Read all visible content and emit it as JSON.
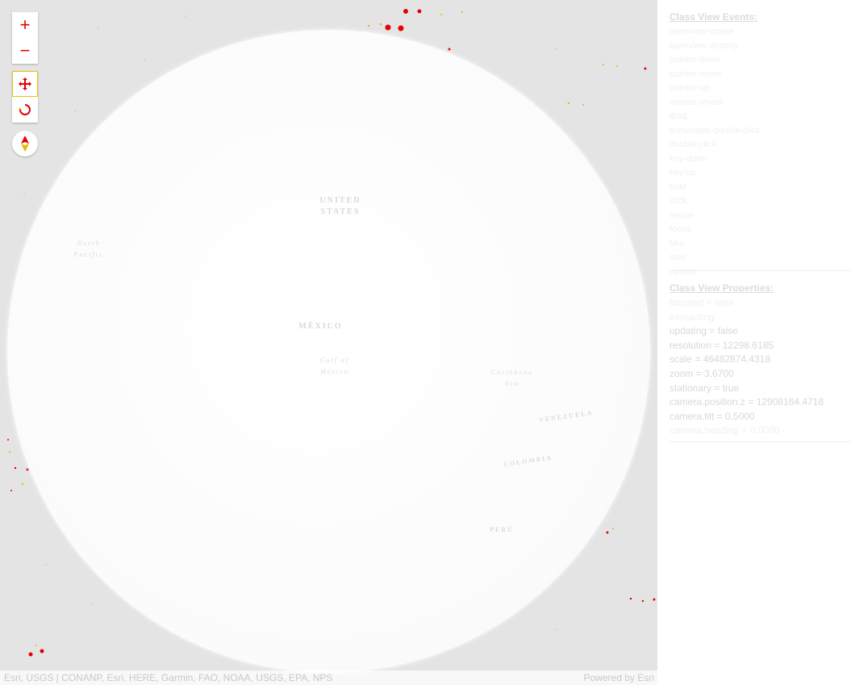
{
  "map": {
    "labels": {
      "united_states": "UNITED STATES",
      "mexico": "MÉXICO",
      "venezuela": "VENEZUELA",
      "colombia": "COLOMBIA",
      "peru": "PERÚ",
      "caribbean": "Caribbean Sea",
      "gulf": "Gulf of Mexico",
      "north_pacific": "North Pacific"
    }
  },
  "controls": {
    "zoom_in": "+",
    "zoom_out": "−",
    "pan_icon": "pan-icon",
    "rotate_icon": "rotate-icon",
    "compass_icon": "compass-icon",
    "accent_color": "#e60000",
    "active_outline_color": "#f0c000"
  },
  "attribution": {
    "sources": "Esri, USGS | CONANP, Esri, HERE, Garmin, FAO, NOAA, USGS, EPA, NPS",
    "powered_by": "Powered by Esri"
  },
  "panel": {
    "events_title": "Class View Events:",
    "events": [
      "layerview-create",
      "layerview-destroy",
      "pointer-down",
      "pointer-move",
      "pointer-up",
      "mouse-wheel",
      "drag",
      "immediate-double-click",
      "double-click",
      "key-down",
      "key-up",
      "hold",
      "click",
      "resize",
      "focus",
      "blur",
      "size",
      "update"
    ],
    "properties_title": "Class View Properties:",
    "properties": [
      {
        "text": "focused = false",
        "faint": true
      },
      {
        "text": "interacting",
        "faint": true
      },
      {
        "text": "updating = false",
        "faint": false
      },
      {
        "text": "resolution = 12298.6185",
        "faint": false
      },
      {
        "text": "scale = 46482874.4318",
        "faint": false
      },
      {
        "text": "zoom = 3.6700",
        "faint": false
      },
      {
        "text": "stationary = true",
        "faint": false
      },
      {
        "text": "camera.position.z = 12908164.4718",
        "faint": false
      },
      {
        "text": "camera.tilt = 0.5000",
        "faint": false
      },
      {
        "text": "camera.heading = 0.0000",
        "faint": true
      }
    ]
  }
}
